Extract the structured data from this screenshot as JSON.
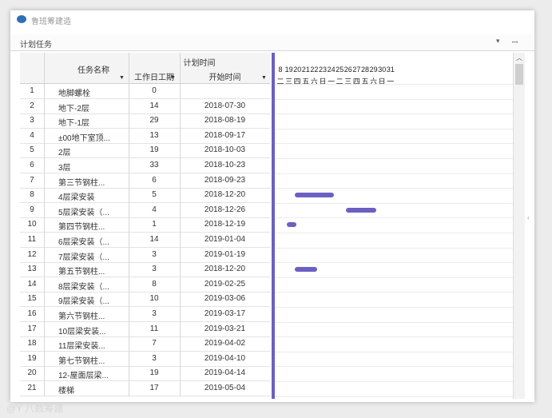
{
  "app": {
    "title": "鲁班筹建造"
  },
  "panel": {
    "title": "计划任务",
    "dropdown_icon": "▾",
    "pin_icon": "ꟷ"
  },
  "table": {
    "headers": {
      "name": "任务名称",
      "plan": "计划时间",
      "duration": "工作日工期",
      "start": "开始时间"
    },
    "rows": [
      {
        "idx": "1",
        "name": "地脚螺栓",
        "duration": "0",
        "start": ""
      },
      {
        "idx": "2",
        "name": "地下-2层",
        "duration": "14",
        "start": "2018-07-30"
      },
      {
        "idx": "3",
        "name": "地下-1层",
        "duration": "29",
        "start": "2018-08-19"
      },
      {
        "idx": "4",
        "name": "±00地下室顶...",
        "duration": "13",
        "start": "2018-09-17"
      },
      {
        "idx": "5",
        "name": "2层",
        "duration": "19",
        "start": "2018-10-03"
      },
      {
        "idx": "6",
        "name": "3层",
        "duration": "33",
        "start": "2018-10-23"
      },
      {
        "idx": "7",
        "name": "第三节钢柱...",
        "duration": "6",
        "start": "2018-09-23"
      },
      {
        "idx": "8",
        "name": "4层梁安装",
        "duration": "5",
        "start": "2018-12-20"
      },
      {
        "idx": "9",
        "name": "5层梁安装（...",
        "duration": "4",
        "start": "2018-12-26"
      },
      {
        "idx": "10",
        "name": "第四节钢柱...",
        "duration": "1",
        "start": "2018-12-19"
      },
      {
        "idx": "11",
        "name": "6层梁安装（...",
        "duration": "14",
        "start": "2019-01-04"
      },
      {
        "idx": "12",
        "name": "7层梁安装（...",
        "duration": "3",
        "start": "2019-01-19"
      },
      {
        "idx": "13",
        "name": "第五节钢柱...",
        "duration": "3",
        "start": "2018-12-20"
      },
      {
        "idx": "14",
        "name": "8层梁安装（...",
        "duration": "8",
        "start": "2019-02-25"
      },
      {
        "idx": "15",
        "name": "9层梁安装（...",
        "duration": "10",
        "start": "2019-03-06"
      },
      {
        "idx": "16",
        "name": "第六节钢柱...",
        "duration": "3",
        "start": "2019-03-17"
      },
      {
        "idx": "17",
        "name": "10层梁安装...",
        "duration": "11",
        "start": "2019-03-21"
      },
      {
        "idx": "18",
        "name": "11层梁安装...",
        "duration": "7",
        "start": "2019-04-02"
      },
      {
        "idx": "19",
        "name": "第七节钢柱...",
        "duration": "3",
        "start": "2019-04-10"
      },
      {
        "idx": "20",
        "name": "12-屋面层梁...",
        "duration": "19",
        "start": "2019-04-14"
      },
      {
        "idx": "21",
        "name": "楼梯",
        "duration": "17",
        "start": "2019-05-04"
      }
    ]
  },
  "gantt": {
    "days": [
      "8",
      "19",
      "20",
      "21",
      "22",
      "23",
      "24",
      "25",
      "26",
      "27",
      "28",
      "29",
      "30",
      "31"
    ],
    "weekdays": [
      "二",
      "三",
      "四",
      "五",
      "六",
      "日",
      "一",
      "二",
      "三",
      "四",
      "五",
      "六",
      "日",
      "一"
    ],
    "bars": [
      {
        "row": 8,
        "start_day": "20",
        "end_day": "24"
      },
      {
        "row": 9,
        "start_day": "26",
        "end_day": "29"
      },
      {
        "row": 10,
        "start_day": "19",
        "end_day": "19"
      },
      {
        "row": 13,
        "start_day": "20",
        "end_day": "22"
      }
    ]
  },
  "watermark": "@Y 八数筹建",
  "icons": {
    "scroll_up": "︿",
    "edge": "‹"
  }
}
